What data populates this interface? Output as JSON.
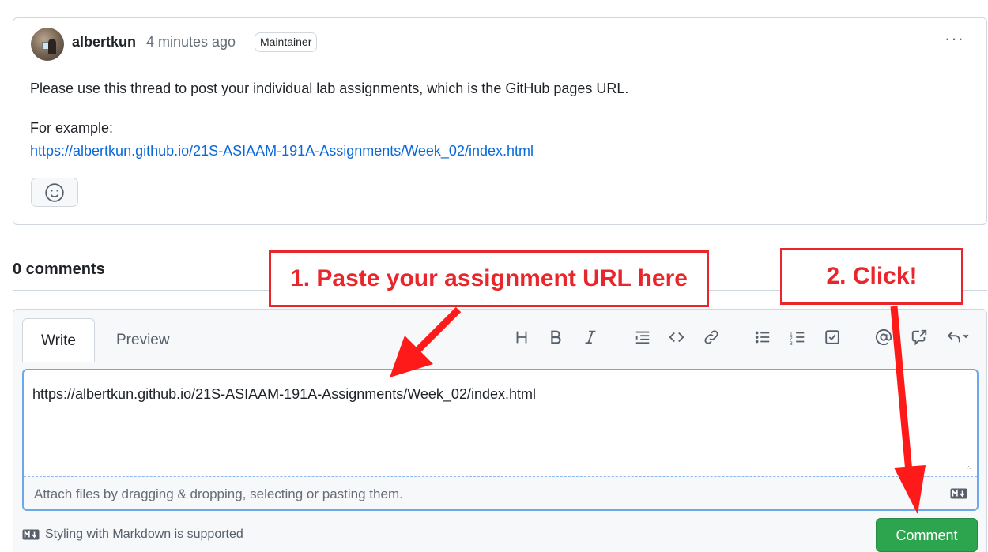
{
  "discussion": {
    "author": "albertkun",
    "time": "4 minutes ago",
    "role_badge": "Maintainer",
    "more_menu": "···",
    "body": "Please use this thread to post your individual lab assignments, which is the GitHub pages URL.",
    "example_label": "For example:",
    "example_link": "https://albertkun.github.io/21S-ASIAAM-191A-Assignments/Week_02/index.html"
  },
  "comments": {
    "count_label": "0 comments"
  },
  "editor": {
    "tabs": [
      {
        "label": "Write",
        "active": true
      },
      {
        "label": "Preview",
        "active": false
      }
    ],
    "toolbar_icons": [
      "heading-icon",
      "bold-icon",
      "italic-icon",
      "quote-icon",
      "code-icon",
      "link-icon",
      "unordered-list-icon",
      "ordered-list-icon",
      "task-list-icon",
      "mention-icon",
      "cross-reference-icon",
      "saved-replies-icon"
    ],
    "text_value": "https://albertkun.github.io/21S-ASIAAM-191A-Assignments/Week_02/index.html",
    "attach_hint": "Attach files by dragging & dropping, selecting or pasting them.",
    "markdown_note": "Styling with Markdown is supported",
    "submit_label": "Comment"
  },
  "annotations": {
    "step1": "1. Paste your assignment URL here",
    "step2": "2. Click!"
  },
  "colors": {
    "accent_link": "#0969da",
    "submit_green": "#2da44e",
    "annotation_red": "#e8262c",
    "focus_border": "#6ea8ec"
  }
}
